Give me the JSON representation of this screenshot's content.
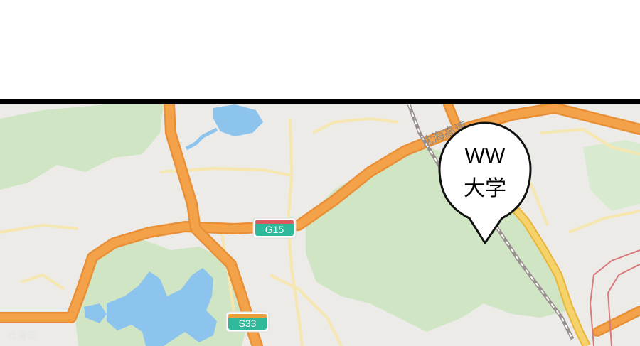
{
  "map": {
    "colors": {
      "background": "#ecebe8",
      "park": "#cfe5c3",
      "water": "#8cc4ee",
      "expressway": "#f4a24a",
      "expressway_casing": "#e98f36",
      "highway_yellow": "#f2c94c",
      "minor_road": "#f6e6b0",
      "rail": "#9a8f8f",
      "boundary": "#d97a7a"
    },
    "shields": [
      {
        "id": "g15",
        "label": "G15",
        "color": "#2fb899"
      },
      {
        "id": "s33",
        "label": "S33",
        "color": "#2fb899"
      }
    ],
    "road_labels": [
      {
        "id": "shenhai-expressway",
        "text": "沈海高速"
      }
    ]
  },
  "pin": {
    "line1": "WW",
    "line2": "大学"
  },
  "watermark": {
    "text": "看漫画"
  }
}
